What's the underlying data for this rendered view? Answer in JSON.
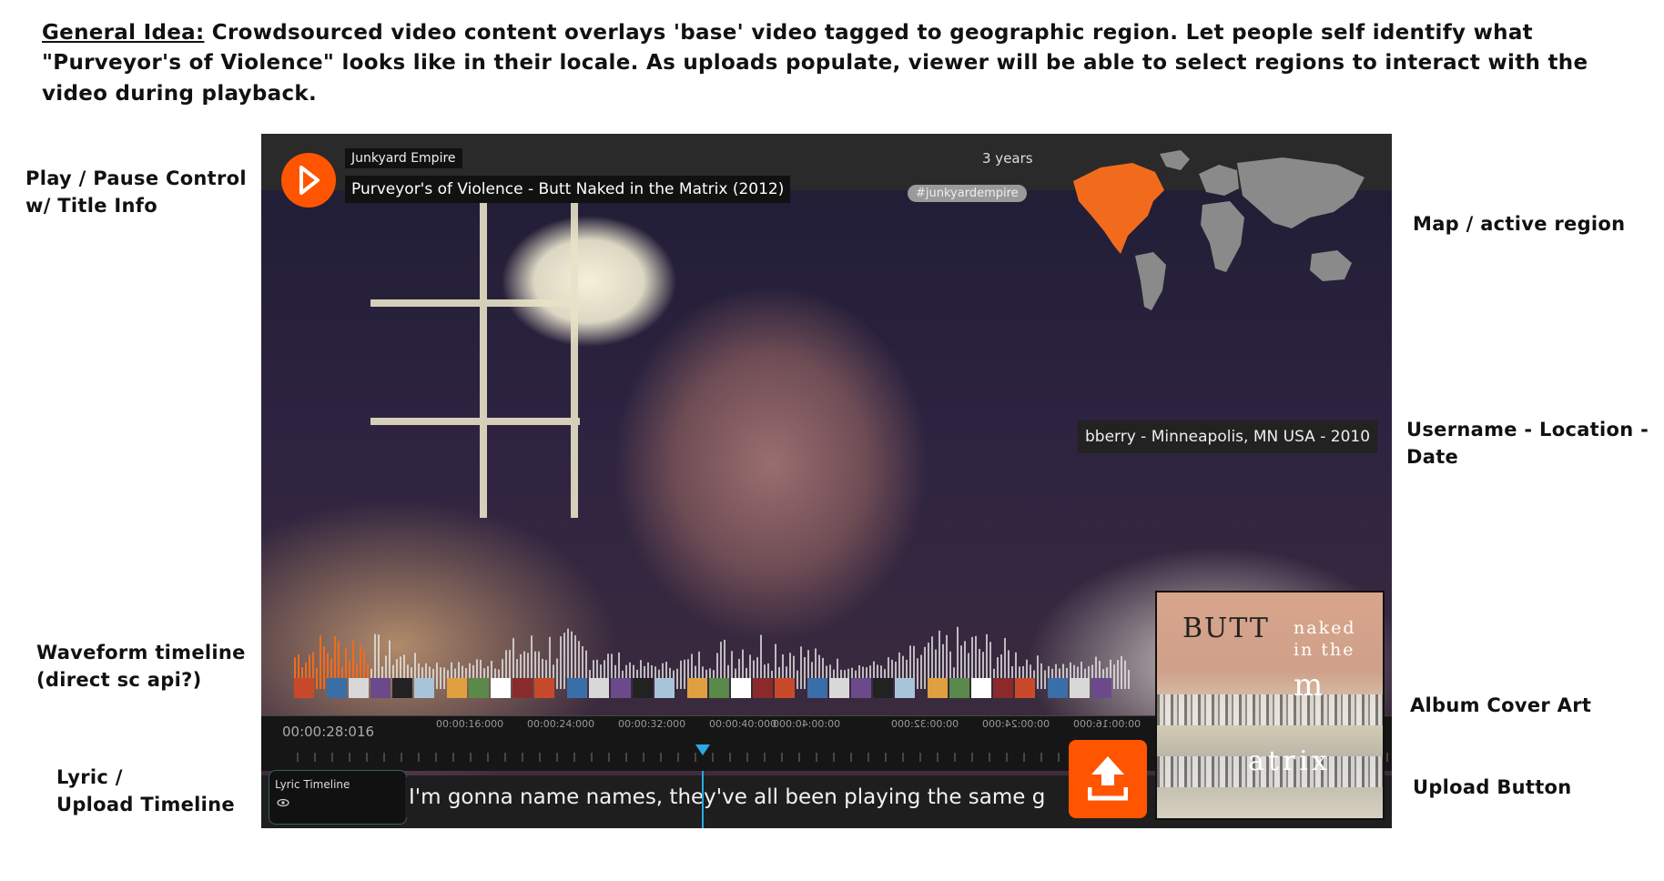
{
  "annotations": {
    "general_idea_label": "General Idea:",
    "general_idea_text": "Crowdsourced video content overlays 'base' video tagged to geographic region.  Let people self identify what \"Purveyor's of Violence\" looks like in their locale. As uploads populate, viewer will be able to select regions to interact with the video during playback.",
    "play_pause_line1": "Play / Pause Control",
    "play_pause_line2": "w/ Title Info",
    "waveform_line1": "Waveform timeline",
    "waveform_line2": "(direct sc api?)",
    "lyric_line1": "Lyric /",
    "lyric_line2": "Upload Timeline",
    "map": "Map / active region",
    "username_line1": "Username - Location -",
    "username_line2": "Date",
    "album": "Album Cover Art",
    "upload": "Upload Button"
  },
  "player": {
    "artist": "Junkyard Empire",
    "title": "Purveyor's of Violence - Butt Naked in the Matrix (2012)",
    "time_ago": "3 years",
    "tag": "#junkyardempire",
    "user_info": "bberry - Minneapolis, MN USA - 2010",
    "progress_fraction": 0.09
  },
  "timeline": {
    "timecode": "00:00:28:016",
    "ticks": [
      "00:00:16:000",
      "00:00:24:000",
      "00:00:32:000",
      "00:00:40:000",
      "00:00:40:000",
      "00:00:32:000",
      "00:00:24:000",
      "00:00:16:000"
    ]
  },
  "lyrics": {
    "label": "Lyric Timeline",
    "text": "I'm gonna name names, they've all been playing the same g"
  },
  "album": {
    "line1": "BUTT",
    "line2": "naked",
    "line3": "in the",
    "line4": "m",
    "line5": "atrix"
  },
  "colors": {
    "accent": "#ff5500",
    "cursor": "#29a9e1",
    "map_active": "#f26b1d",
    "map_inactive": "#8a8a8a"
  },
  "icons": {
    "play": "play-icon",
    "upload": "upload-icon",
    "map": "world-map-icon",
    "eye": "eye-icon"
  }
}
